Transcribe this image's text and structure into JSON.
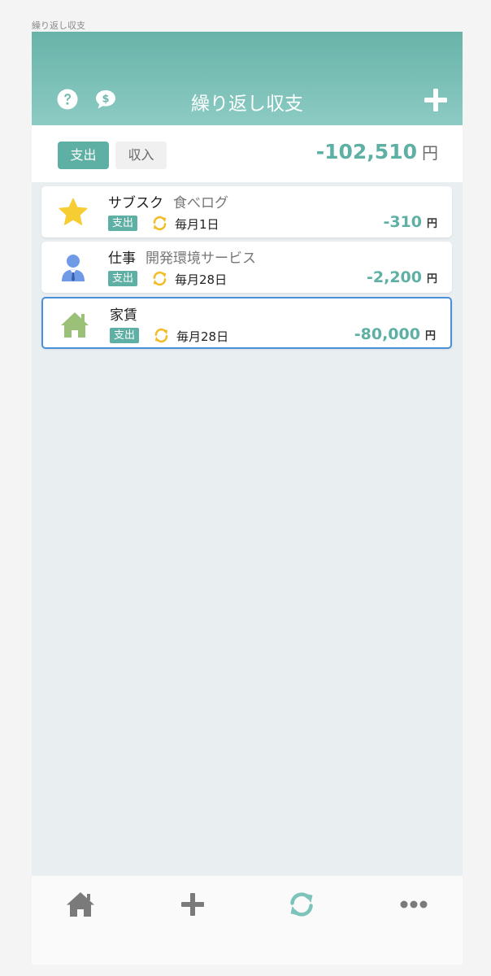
{
  "page_caption": "繰り返し収支",
  "header": {
    "title": "繰り返し収支",
    "icons": [
      "question-circle-icon",
      "money-speech-icon",
      "plus-icon"
    ],
    "colors": {
      "top": "#68b3a9",
      "bottom": "#8ccbc3"
    }
  },
  "summary": {
    "tabs": [
      {
        "label": "支出",
        "selected": true
      },
      {
        "label": "収入",
        "selected": false
      }
    ],
    "total_amount": "-102,510",
    "currency": "円"
  },
  "items": [
    {
      "icon": "star-icon",
      "category": "サブスク",
      "memo": "食べログ",
      "type_badge": "支出",
      "frequency": "毎月1日",
      "amount": "-310",
      "currency": "円",
      "selected": false
    },
    {
      "icon": "person-icon",
      "category": "仕事",
      "memo": "開発環境サービス",
      "type_badge": "支出",
      "frequency": "毎月28日",
      "amount": "-2,200",
      "currency": "円",
      "selected": false
    },
    {
      "icon": "house-icon",
      "category": "家賃",
      "memo": "",
      "type_badge": "支出",
      "frequency": "毎月28日",
      "amount": "-80,000",
      "currency": "円",
      "selected": true
    }
  ],
  "tabbar": {
    "icons": [
      "home-icon",
      "plus-icon",
      "recurring-icon",
      "more-icon"
    ],
    "active_index": 2,
    "active_color": "#7cc4ba",
    "inactive_color": "#7a7a7a"
  },
  "colors": {
    "accent": "#5fb0a4",
    "repeat_icon": "#f2bd2b",
    "selected_border": "#4a90d9"
  }
}
